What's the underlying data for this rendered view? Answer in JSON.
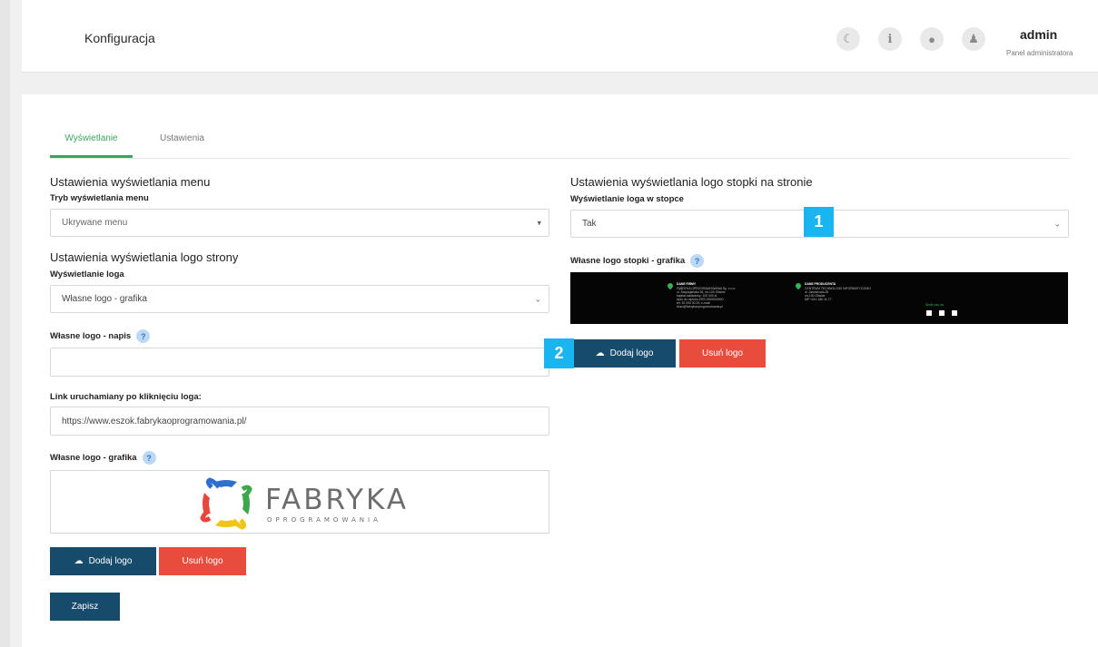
{
  "header": {
    "title": "Konfiguracja",
    "icons": [
      "moon-icon",
      "info-icon",
      "globe-icon",
      "user-icon"
    ],
    "user": {
      "name": "admin",
      "role": "Panel administratora"
    }
  },
  "tabs": [
    {
      "label": "Wyświetlanie",
      "active": true
    },
    {
      "label": "Ustawienia",
      "active": false
    }
  ],
  "left": {
    "menu_section_title": "Ustawienia wyświetlania menu",
    "menu_mode_label": "Tryb wyświetlania menu",
    "menu_mode_value": "Ukrywane menu",
    "logo_section_title": "Ustawienia wyświetlania logo strony",
    "logo_display_label": "Wyświetlanie loga",
    "logo_display_value": "Własne logo - grafika",
    "logo_text_label": "Własne logo - napis",
    "logo_text_value": "",
    "link_label": "Link uruchamiany po kliknięciu loga:",
    "link_value": "https://www.eszok.fabrykaoprogramowania.pl/",
    "logo_graphic_label": "Własne logo - grafika",
    "logo_brand": {
      "name": "FABRYKA",
      "sub": "OPROGRAMOWANIA"
    },
    "add_logo_label": "Dodaj logo",
    "remove_logo_label": "Usuń logo",
    "save_label": "Zapisz"
  },
  "right": {
    "footer_section_title": "Ustawienia wyświetlania logo stopki na stronie",
    "footer_display_label": "Wyświetlanie loga w stopce",
    "footer_display_value": "Tak",
    "footer_graphic_label": "Własne logo stopki - grafika",
    "footer_preview": {
      "col1_title": "DANE FIRMY",
      "col1_lines": "FABRYKA OPROGRAMOWANIA Sp. z o.o.\nul. Świętojańska 35, nn-100 Gliwice\nkapitał zakładowy: 100 000 zł\nwpis do rejestru KRS 0000000000\ntel: 32 000 00 00, e-mail:\nbiuro@fabrykaoprogramowania.pl",
      "col2_title": "DANE PRODUCENTA",
      "col2_lines": "CENTRUM TECHNOLOGII INFORMATYCZNEJ\nul. Jaśminowa 35\nnn-100 Gliwice\nNIP: 631-180-11-77",
      "follow_label": "Śledź nas na:"
    },
    "add_logo_label": "Dodaj logo",
    "remove_logo_label": "Usuń logo"
  },
  "annotations": {
    "badge1": "1",
    "badge2": "2"
  },
  "colors": {
    "accent_green": "#3ba55c",
    "primary": "#164b6c",
    "danger": "#e74c3c",
    "badge": "#18b5f1",
    "help": "#bcd8f5"
  }
}
